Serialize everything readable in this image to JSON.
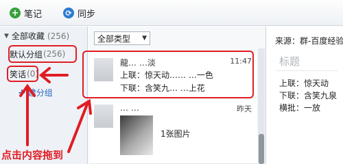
{
  "toolbar": {
    "note_label": "笔记",
    "sync_label": "同步"
  },
  "sidebar": {
    "all_label": "全部收藏",
    "all_count": "(256)",
    "items": [
      {
        "label": "默认分组",
        "count": "(256)"
      },
      {
        "label": "笑话",
        "count": "(0)"
      }
    ],
    "new_group_label": "建分组"
  },
  "list": {
    "type_select": "全部类型",
    "items": [
      {
        "title": "龍… …淡",
        "time": "11:47",
        "line1": "上联：惊天动…… …一色",
        "line2": "下联：含笑九… …上花"
      },
      {
        "title": "… …",
        "time": "昨天",
        "attachment": "1张图片"
      }
    ]
  },
  "detail": {
    "source": "来源：群-百度经验",
    "title_placeholder": "标题",
    "lines": [
      "上联：惊天动",
      "下联：含笑九泉",
      "横批：一放"
    ]
  },
  "annotation": {
    "caption": "点击内容拖到",
    "color": "#e11c24"
  }
}
